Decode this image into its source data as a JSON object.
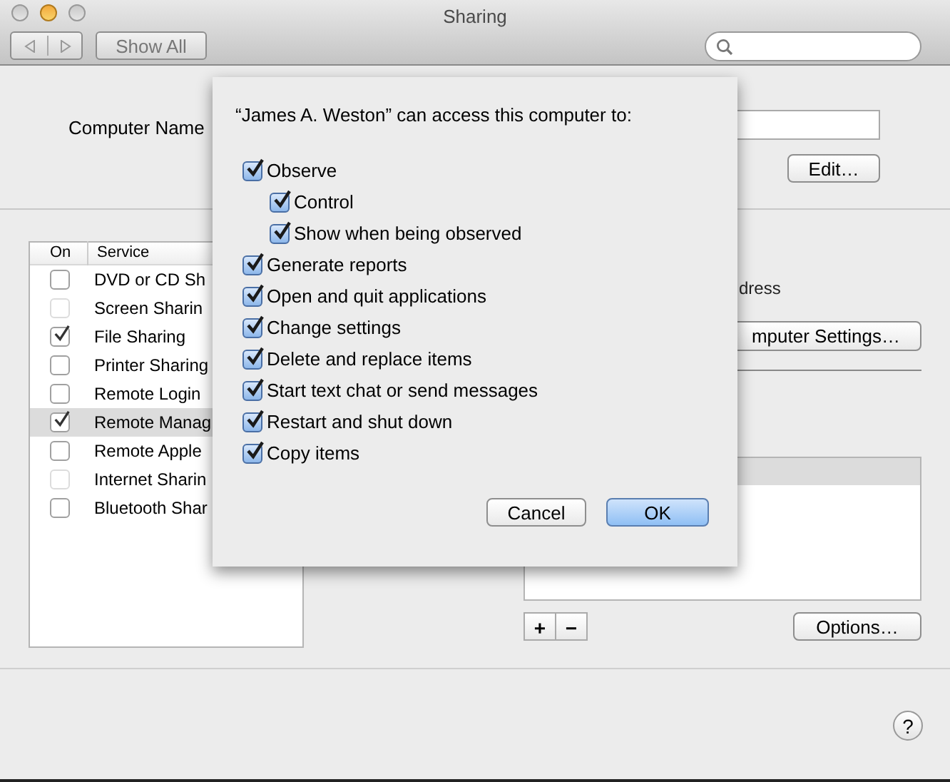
{
  "window": {
    "title": "Sharing"
  },
  "toolbar": {
    "show_all": "Show All"
  },
  "computer_name": {
    "label": "Computer Name",
    "edit_button": "Edit…"
  },
  "services": {
    "columns": [
      "On",
      "Service"
    ],
    "rows": [
      {
        "name": "DVD or CD Sh",
        "checked": false,
        "disabled": false,
        "selected": false
      },
      {
        "name": "Screen Sharin",
        "checked": false,
        "disabled": true,
        "selected": false
      },
      {
        "name": "File Sharing",
        "checked": true,
        "disabled": false,
        "selected": false
      },
      {
        "name": "Printer Sharing",
        "checked": false,
        "disabled": false,
        "selected": false
      },
      {
        "name": "Remote Login",
        "checked": false,
        "disabled": false,
        "selected": false
      },
      {
        "name": "Remote Manag",
        "checked": true,
        "disabled": false,
        "selected": true
      },
      {
        "name": "Remote Apple",
        "checked": false,
        "disabled": false,
        "selected": false
      },
      {
        "name": "Internet Sharin",
        "checked": false,
        "disabled": true,
        "selected": false
      },
      {
        "name": "Bluetooth Shar",
        "checked": false,
        "disabled": false,
        "selected": false
      }
    ]
  },
  "detail": {
    "text": "dress",
    "settings_button": "mputer Settings…",
    "add_button": "+",
    "remove_button": "−",
    "options_button": "Options…"
  },
  "help_button": "?",
  "sheet": {
    "title": "“James A. Weston” can access this computer to:",
    "permissions": [
      {
        "label": "Observe",
        "checked": true,
        "children": [
          {
            "label": "Control",
            "checked": true
          },
          {
            "label": "Show when being observed",
            "checked": true
          }
        ]
      },
      {
        "label": "Generate reports",
        "checked": true
      },
      {
        "label": "Open and quit applications",
        "checked": true
      },
      {
        "label": "Change settings",
        "checked": true
      },
      {
        "label": "Delete and replace items",
        "checked": true
      },
      {
        "label": "Start text chat or send messages",
        "checked": true
      },
      {
        "label": "Restart and shut down",
        "checked": true
      },
      {
        "label": "Copy items",
        "checked": true
      }
    ],
    "buttons": [
      {
        "label": "Cancel",
        "default": false
      },
      {
        "label": "OK",
        "default": true
      }
    ]
  }
}
